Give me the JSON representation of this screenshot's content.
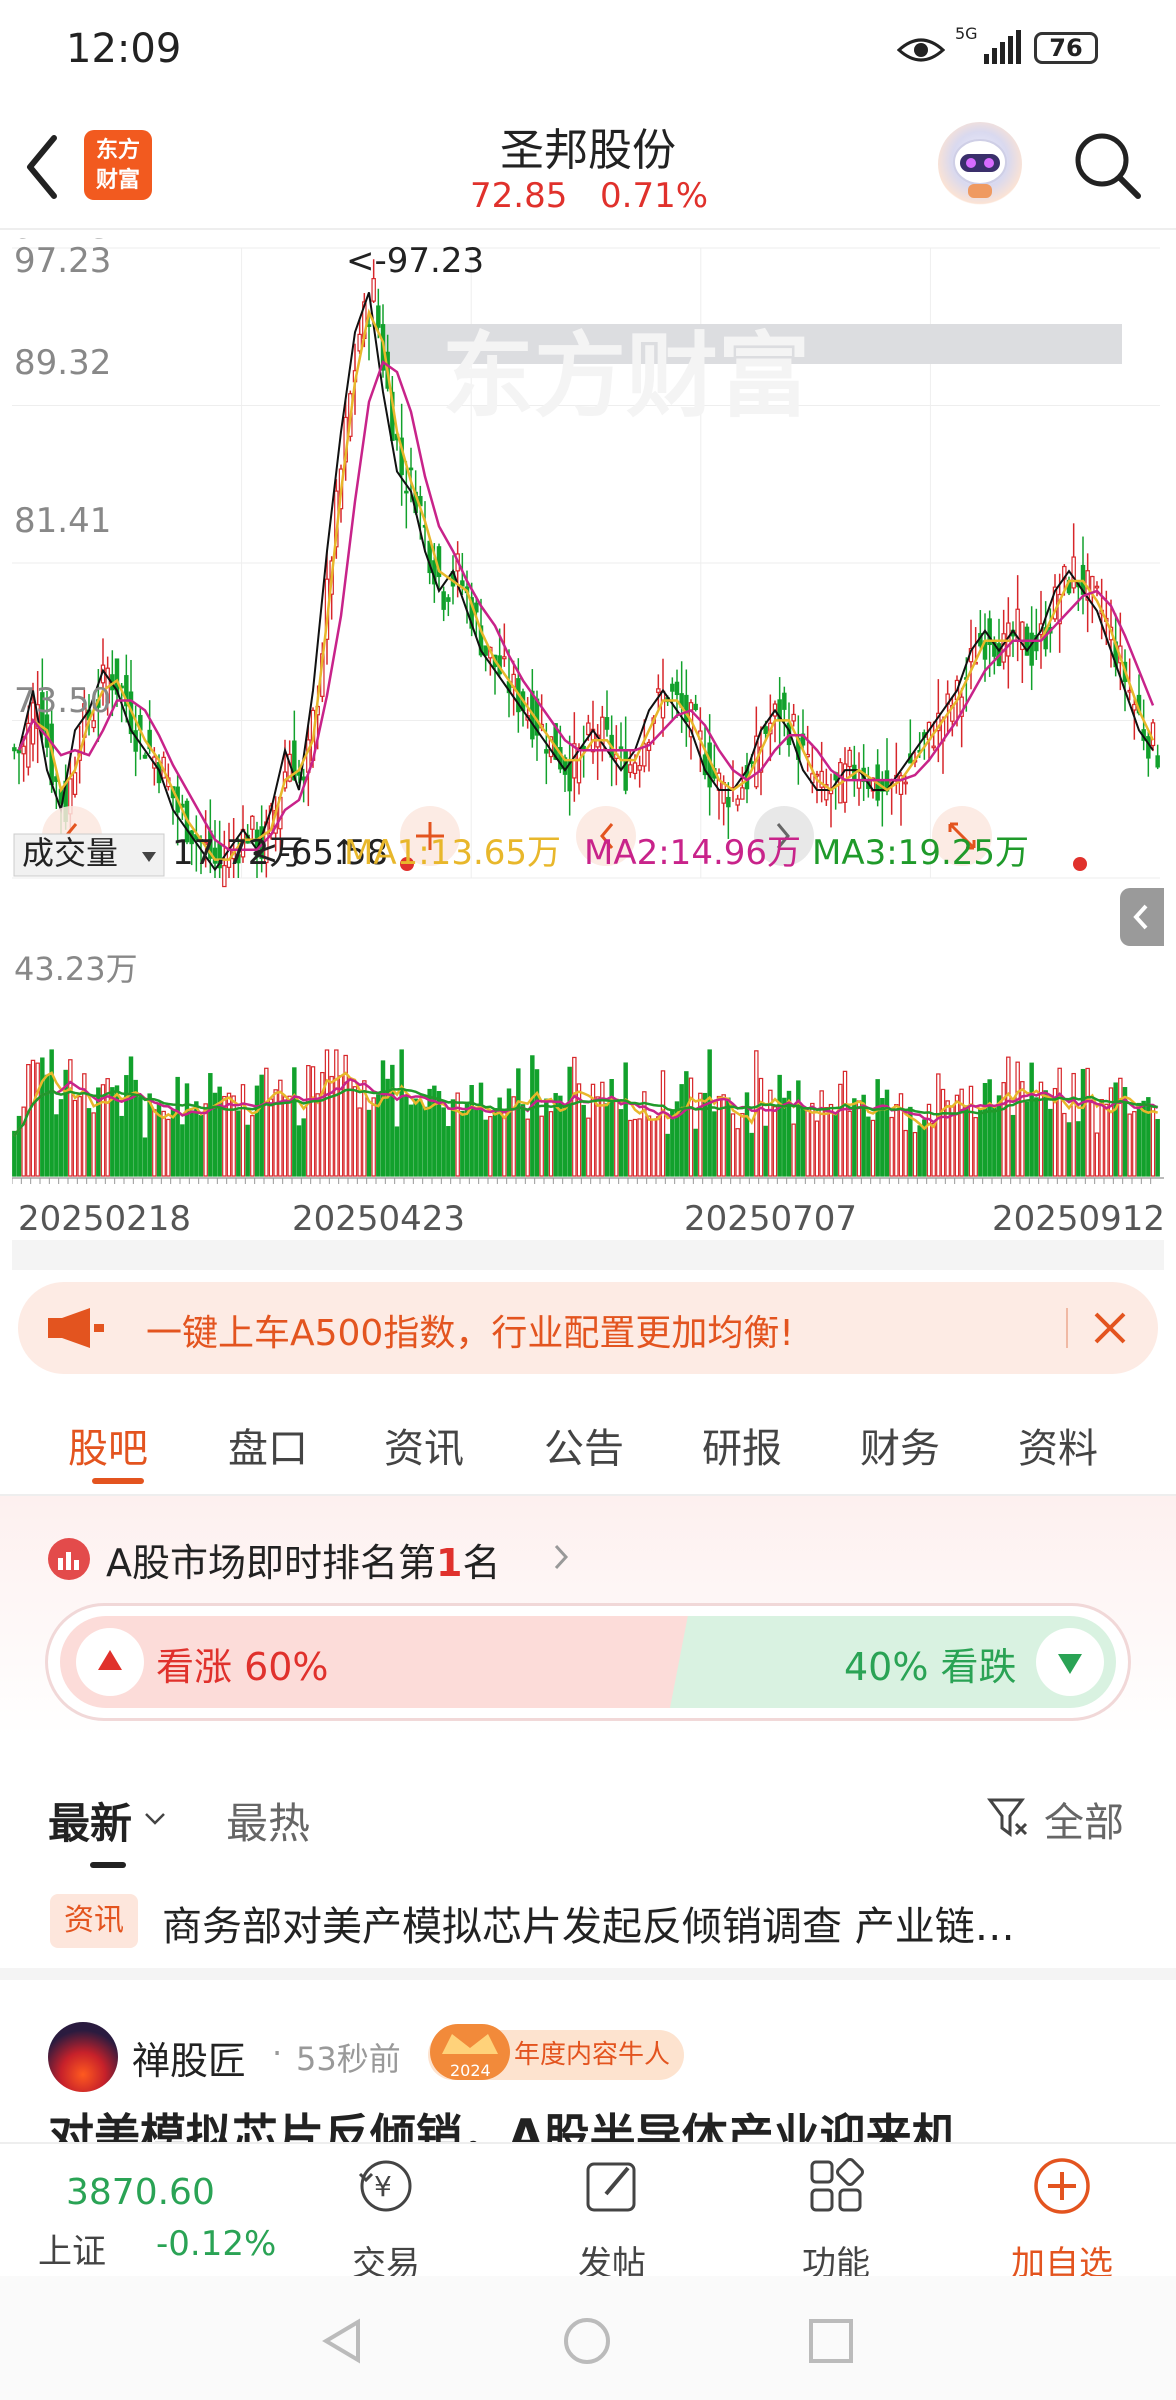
{
  "status_bar": {
    "time": "12:09",
    "network": "5G",
    "battery": "76"
  },
  "header": {
    "title": "圣邦股份",
    "price": "72.85",
    "change_pct": "0.71%"
  },
  "price_chart": {
    "y_labels": [
      "97.23",
      "89.32",
      "81.41",
      "73.50",
      "65.58"
    ],
    "high_marker": "<-97.23",
    "low_marker": "<-65.58",
    "watermark": "东方财富",
    "indicator_select": "成交量",
    "volume_value": "17.72万",
    "ma1": "MA1:13.65万",
    "ma2": "MA2:14.96万",
    "ma3": "MA3:19.25万",
    "volume_max_label": "43.23万",
    "x_labels": [
      "20250218",
      "20250423",
      "20250707",
      "20250912"
    ],
    "colors": {
      "up": "#d7262a",
      "down": "#12a12c",
      "ma1": "#e8b72b",
      "ma2": "#c8238a",
      "ma3": "#1f9a2a",
      "black": "#111111"
    }
  },
  "chart_data": {
    "type": "candlestick",
    "title": "",
    "x_range": [
      "20250218",
      "20250912"
    ],
    "x_ticks": [
      "20250218",
      "20250423",
      "20250707",
      "20250912"
    ],
    "ylim": [
      65.58,
      97.23
    ],
    "y_ticks": [
      97.23,
      89.32,
      81.41,
      73.5,
      65.58
    ],
    "period_high": 97.23,
    "period_low": 65.58,
    "close_series": [
      72,
      75,
      71,
      69,
      73,
      74,
      76,
      75,
      73,
      72,
      71,
      69,
      68,
      67,
      66,
      67,
      68,
      67,
      69,
      72,
      70,
      75,
      82,
      88,
      93,
      95,
      90,
      86,
      85,
      82,
      80,
      81,
      79,
      77,
      76,
      75,
      74,
      73,
      72,
      71,
      72,
      73,
      72,
      71,
      72,
      74,
      75,
      74,
      73,
      71,
      70,
      70,
      71,
      73,
      74,
      73,
      71,
      70,
      70,
      71,
      71,
      70,
      70,
      71,
      72,
      73,
      74,
      75,
      77,
      78,
      77,
      78,
      77,
      78,
      80,
      81,
      80,
      79,
      77,
      75,
      73,
      72
    ],
    "volume_ylim_max": "43.23万",
    "series": [
      {
        "name": "MA1",
        "last": "13.65万"
      },
      {
        "name": "MA2",
        "last": "14.96万"
      },
      {
        "name": "MA3",
        "last": "19.25万"
      }
    ],
    "volume_current": "17.72万"
  },
  "notice": {
    "text": "一键上车A500指数，行业配置更加均衡!"
  },
  "tabs": [
    {
      "label": "股吧",
      "active": true
    },
    {
      "label": "盘口"
    },
    {
      "label": "资讯"
    },
    {
      "label": "公告"
    },
    {
      "label": "研报"
    },
    {
      "label": "财务"
    },
    {
      "label": "资料"
    }
  ],
  "rank": {
    "prefix": "A股市场即时排名第",
    "rank": "1",
    "suffix": "名"
  },
  "vote": {
    "up_label": "看涨 60%",
    "down_label": "40% 看跌",
    "up_fraction": 0.6,
    "down_fraction": 0.4
  },
  "feed_filter": {
    "latest": "最新",
    "hot": "最热",
    "all": "全部"
  },
  "news": {
    "tag": "资讯",
    "title": "商务部对美产模拟芯片发起反倾销调查 产业链…"
  },
  "post": {
    "user": "禅股匠",
    "time": "53秒前",
    "badge": "年度内容牛人",
    "badge_year": "2024",
    "title": "对美模拟芯片反倾销，A股半导体产业迎来机"
  },
  "bottom_bar": {
    "index_value": "3870.60",
    "index_name": "上证",
    "index_change": "-0.12%",
    "items": [
      {
        "label": "交易"
      },
      {
        "label": "发帖"
      },
      {
        "label": "功能"
      },
      {
        "label": "加自选"
      }
    ]
  }
}
